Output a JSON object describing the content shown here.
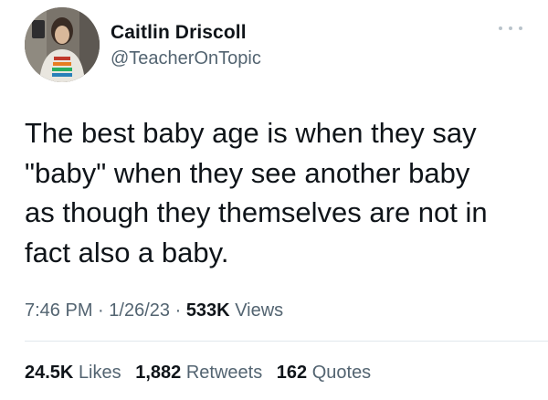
{
  "author": {
    "name": "Caitlin Driscoll",
    "handle": "@TeacherOnTopic"
  },
  "tweet": {
    "text": "The best baby age is when they say\n\"baby\" when they see another baby\nas though they themselves are not in\nfact also a baby.",
    "time": "7:46 PM",
    "separator": "·",
    "date": "1/26/23",
    "views_count": "533K",
    "views_label": "Views"
  },
  "stats": {
    "likes_count": "24.5K",
    "likes_label": "Likes",
    "retweets_count": "1,882",
    "retweets_label": "Retweets",
    "quotes_count": "162",
    "quotes_label": "Quotes"
  },
  "icons": {
    "more": "more-options-icon",
    "avatar": "profile-avatar"
  },
  "colors": {
    "text_primary": "#0f1419",
    "text_secondary": "#536471",
    "divider": "#e1e8ed"
  }
}
